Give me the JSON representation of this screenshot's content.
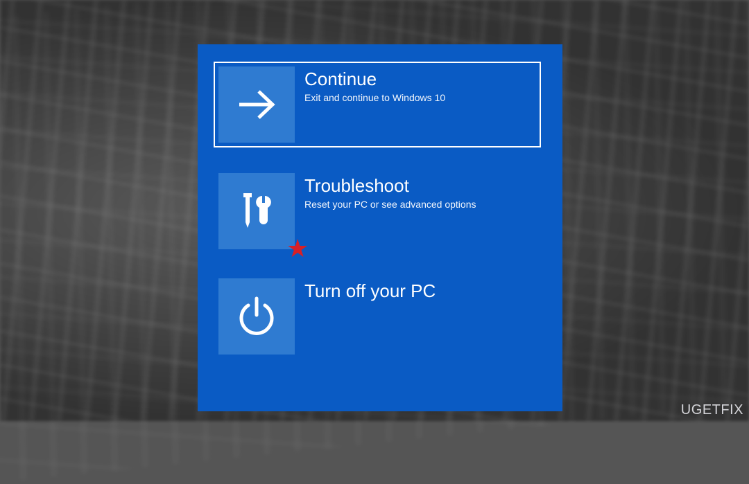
{
  "options": [
    {
      "title": "Continue",
      "desc": "Exit and continue to Windows 10",
      "icon": "arrow-right",
      "selected": true
    },
    {
      "title": "Troubleshoot",
      "desc": "Reset your PC or see advanced options",
      "icon": "tools",
      "selected": false
    },
    {
      "title": "Turn off your PC",
      "desc": "",
      "icon": "power",
      "selected": false
    }
  ],
  "watermark": "UGETFIX",
  "accent_tile": "#2f7bd1",
  "panel_bg": "#0a5bc4",
  "marker": "★"
}
